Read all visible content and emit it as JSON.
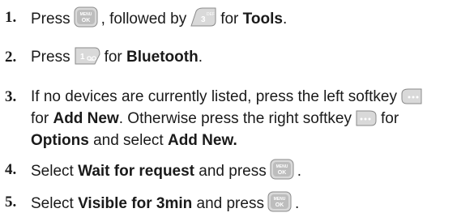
{
  "steps": [
    {
      "number": "1.",
      "press": "Press",
      "key1_icon": "menu-ok-key-icon",
      "followed_by": ", followed by",
      "key2_icon": "three-def-key-icon",
      "key2_main": "3",
      "key2_sub": "DEF",
      "for": "for",
      "target": "Tools",
      "end": "."
    },
    {
      "number": "2.",
      "press": "Press",
      "key_icon": "one-voicemail-key-icon",
      "key_main": "1",
      "for": "for",
      "target": "Bluetooth",
      "end": "."
    },
    {
      "number": "3.",
      "text_a": "If no devices are currently listed, press the left softkey",
      "left_softkey_icon": "left-softkey-icon",
      "for_a": "for",
      "target_a": "Add New",
      "text_b": ". Otherwise press the right softkey",
      "right_softkey_icon": "right-softkey-icon",
      "for_b": "for",
      "target_b": "Options",
      "text_c": "and select",
      "target_c": "Add New."
    },
    {
      "number": "4.",
      "select": "Select",
      "target": "Wait for request",
      "and_press": "and press",
      "key_icon": "menu-ok-key-icon",
      "end": "."
    },
    {
      "number": "5.",
      "select": "Select",
      "target": "Visible for 3min",
      "and_press": "and press",
      "key_icon": "menu-ok-key-icon",
      "end": "."
    }
  ],
  "key_labels": {
    "menu": "MENU",
    "ok": "OK"
  },
  "colors": {
    "key_face": "#d9d9d9",
    "key_edge": "#8a8a8a",
    "text": "#1a1a1a"
  }
}
